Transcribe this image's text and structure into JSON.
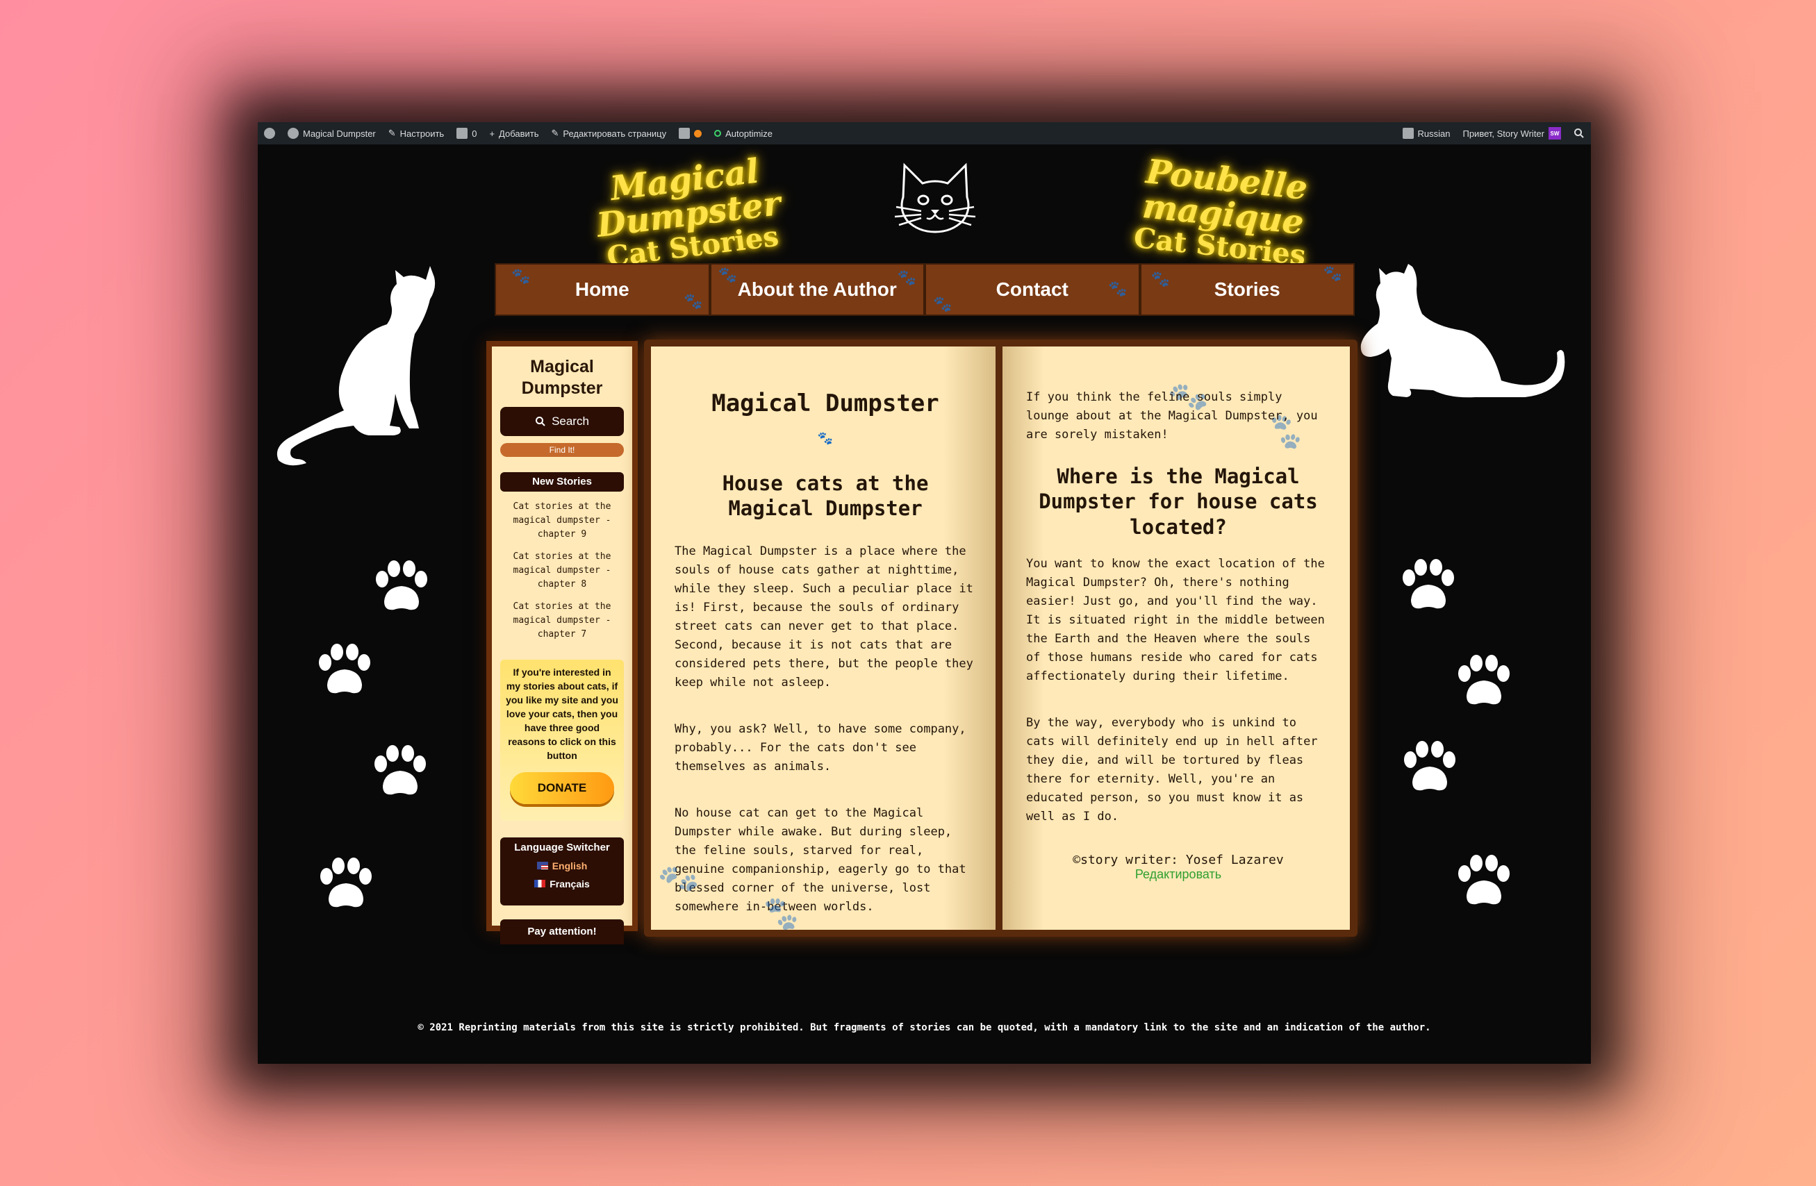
{
  "admin_bar": {
    "site_name": "Magical Dumpster",
    "customize": "Настроить",
    "comments_count": "0",
    "new": "Добавить",
    "edit_page": "Редактировать страницу",
    "autoptimize": "Autoptimize",
    "language": "Russian",
    "greeting": "Привет, Story Writer",
    "avatar_initials": "SW"
  },
  "header": {
    "logo_left_line1": "Magical Dumpster",
    "logo_left_line2": "Cat Stories",
    "logo_right_line1": "Poubelle magique",
    "logo_right_line2": "Cat Stories"
  },
  "nav": [
    "Home",
    "About the Author",
    "Contact",
    "Stories"
  ],
  "sidebar": {
    "title": "Magical Dumpster",
    "search_label": "Search",
    "find_label": "Find It!",
    "new_stories_heading": "New Stories",
    "stories": [
      "Cat stories at the magical dumpster - chapter 9",
      "Cat stories at the magical dumpster - chapter 8",
      "Cat stories at the magical dumpster - chapter 7"
    ],
    "donate_text": "If you're interested in my stories about cats, if you like my site and you love your cats, then you have three good reasons to click on this button",
    "donate_button": "DONATE",
    "language_heading": "Language Switcher",
    "languages": [
      "English",
      "Français"
    ],
    "attention": "Pay attention!"
  },
  "book": {
    "title": "Magical Dumpster",
    "left_heading": "House cats at the Magical Dumpster",
    "left_paragraphs": [
      "The Magical Dumpster is a place where the souls of house cats gather at nighttime, while they sleep. Such a peculiar place it is! First, because the souls of ordinary street cats can never get to that place. Second, because it is not cats that are considered pets there, but the people they keep while not asleep.",
      "Why, you ask? Well, to have some company, probably... For the cats don't see themselves as animals.",
      "No house cat can get to the Magical Dumpster while awake. But during sleep, the feline souls, starved for real, genuine companionship, eagerly go to that blessed corner of the universe, lost somewhere in-between worlds."
    ],
    "right_intro": "If you think the feline souls simply lounge about at the Magical Dumpster, you are sorely mistaken!",
    "right_heading": "Where is the Magical Dumpster for house cats located?",
    "right_paragraphs": [
      "You want to know the exact location of the Magical Dumpster? Oh, there's nothing easier! Just go, and you'll find the way. It is situated right in the middle between the Earth and the Heaven where the souls of those humans reside who cared for cats affectionately during their lifetime.",
      "By the way, everybody who is unkind to cats will definitely end up in hell after they die, and will be tortured by fleas there for eternity. Well, you're an educated person, so you must know it as well as I do."
    ],
    "signature": "©story writer: Yosef Lazarev",
    "edit_link": "Редактировать"
  },
  "footer": "© 2021 Reprinting materials from this site is strictly prohibited. But fragments of stories can be quoted, with a mandatory link to the site and an indication of the author.",
  "colors": {
    "background_gradient": "#ff8fa0",
    "page_bg": "#090909",
    "nav_bg": "#7a3a14",
    "paper": "#ffe9b8",
    "neon_yellow": "#ffe24a",
    "link_green": "#2fa02f"
  }
}
